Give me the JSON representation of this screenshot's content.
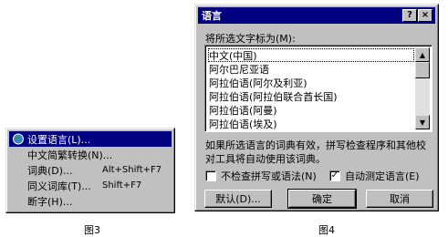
{
  "menu": {
    "items": [
      {
        "label": "设置语言(L)...",
        "shortcut": ""
      },
      {
        "label": "中文简繁转换(N)...",
        "shortcut": ""
      },
      {
        "label": "词典(D)...",
        "shortcut": "Alt+Shift+F7"
      },
      {
        "label": "同义词库(T)...",
        "shortcut": "Shift+F7"
      },
      {
        "label": "断字(H)...",
        "shortcut": ""
      }
    ],
    "caption": "图3"
  },
  "dialog": {
    "title": "语言",
    "help_label": "?",
    "close_label": "×",
    "prompt": "将所选文字标为(M):",
    "languages": [
      "中文(中国)",
      "阿尔巴尼亚语",
      "阿拉伯语(阿尔及利亚)",
      "阿拉伯语(阿拉伯联合酋长国)",
      "阿拉伯语(阿曼)",
      "阿拉伯语(埃及)"
    ],
    "note": "如果所选语言的词典有效，拼写检查程序和其他校对工具将自动使用该词典。",
    "checkbox_no_check": {
      "label": "不检查拼写或语法(N)",
      "checked": false
    },
    "checkbox_auto_detect": {
      "label": "自动测定语言(E)",
      "checked": true
    },
    "btn_default": "默认(D)...",
    "btn_ok": "确定",
    "btn_cancel": "取消",
    "caption": "图4"
  },
  "colors": {
    "highlight": "#000080",
    "face": "#c0c0c0"
  }
}
